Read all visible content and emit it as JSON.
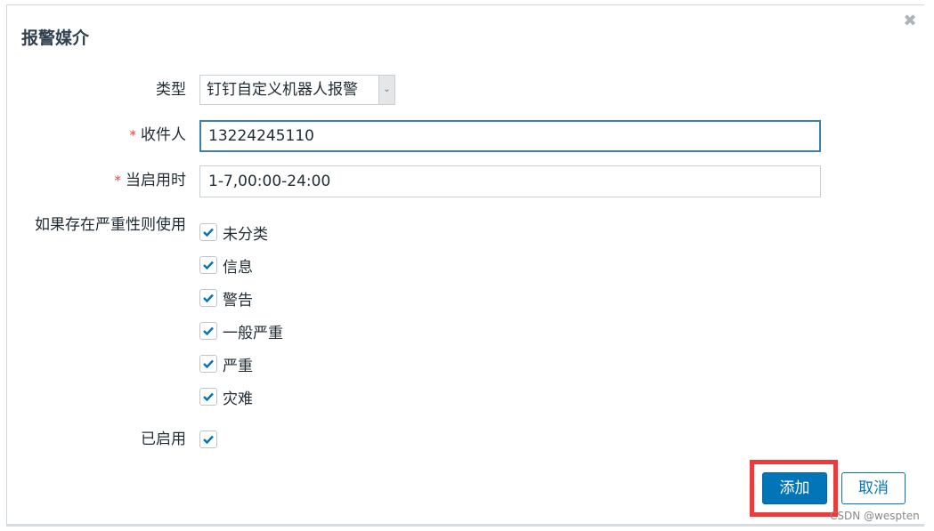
{
  "dialog": {
    "title": "报警媒介",
    "close_icon": "close-icon"
  },
  "form": {
    "type": {
      "label": "类型",
      "value": "钉钉自定义机器人报警",
      "arrow_icon": "chevron-down-icon"
    },
    "recipient": {
      "required_mark": "*",
      "label": "收件人",
      "value": "13224245110"
    },
    "active_when": {
      "required_mark": "*",
      "label": "当启用时",
      "value": "1-7,00:00-24:00"
    },
    "severity": {
      "label": "如果存在严重性则使用",
      "options": [
        {
          "label": "未分类",
          "checked": true
        },
        {
          "label": "信息",
          "checked": true
        },
        {
          "label": "警告",
          "checked": true
        },
        {
          "label": "一般严重",
          "checked": true
        },
        {
          "label": "严重",
          "checked": true
        },
        {
          "label": "灾难",
          "checked": true
        }
      ]
    },
    "enabled": {
      "label": "已启用",
      "checked": true
    }
  },
  "buttons": {
    "add_label": "添加",
    "cancel_label": "取消"
  },
  "colors": {
    "primary": "#0275b8",
    "highlight": "#f03a3a",
    "required": "#e44444"
  },
  "watermark": "CSDN @wespten"
}
